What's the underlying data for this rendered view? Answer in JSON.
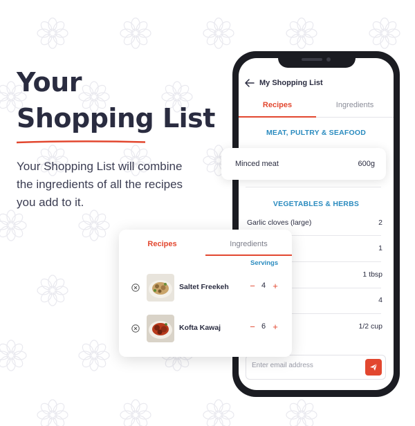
{
  "promo": {
    "headline_line1": "Your",
    "headline_line2": "Shopping List",
    "description": "Your Shopping List will combine the ingredients of all the recipes you add to it."
  },
  "app": {
    "title": "My Shopping List",
    "tabs": [
      {
        "label": "Recipes",
        "active": true
      },
      {
        "label": "Ingredients",
        "active": false
      }
    ],
    "sections": [
      {
        "title": "MEAT, PULTRY & SEAFOOD",
        "items": [
          {
            "name": "Minced meat",
            "qty": "600g"
          }
        ]
      },
      {
        "title": "VEGETABLES & HERBS",
        "items": [
          {
            "name": "Garlic cloves (large)",
            "qty": "2"
          },
          {
            "name": "",
            "qty": "1"
          },
          {
            "name": "",
            "qty": "1 tbsp"
          },
          {
            "name": "",
            "qty": "4"
          },
          {
            "name": "",
            "qty": "1/2 cup"
          }
        ]
      }
    ],
    "email": {
      "placeholder": "Enter email address"
    }
  },
  "recipes_card": {
    "tabs": [
      {
        "label": "Recipes",
        "active": true
      },
      {
        "label": "Ingredients",
        "active": false
      }
    ],
    "servings_label": "Servings",
    "recipes": [
      {
        "name": "Saltet Freekeh",
        "servings": "4"
      },
      {
        "name": "Kofta Kawaj",
        "servings": "6"
      }
    ],
    "minus_symbol": "−",
    "plus_symbol": "+"
  },
  "colors": {
    "accent": "#e2472f",
    "section_title": "#2a8bbf",
    "headline": "#2a2c40"
  }
}
